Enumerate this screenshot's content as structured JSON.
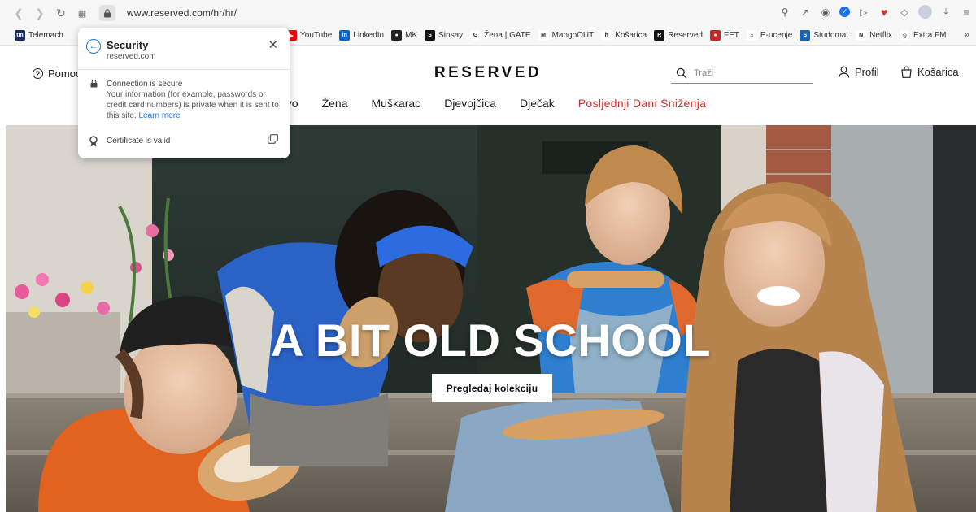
{
  "browser": {
    "url": "www.reserved.com/hr/hr/",
    "bookmarks_left": [
      {
        "label": "Telemach",
        "icon": "telemach-icon",
        "color": "#1d2d5a",
        "glyph": "tm"
      }
    ],
    "bookmarks_right": [
      {
        "label": "YouTube",
        "icon": "youtube-icon",
        "color": "#ff0000",
        "glyph": "▶"
      },
      {
        "label": "LinkedIn",
        "icon": "linkedin-icon",
        "color": "#0a66c2",
        "glyph": "in"
      },
      {
        "label": "MK",
        "icon": "mk-icon",
        "color": "#222222",
        "glyph": "●"
      },
      {
        "label": "Sinsay",
        "icon": "sinsay-icon",
        "color": "#111111",
        "glyph": "S"
      },
      {
        "label": "Žena | GATE",
        "icon": "gate-icon",
        "color": "#ffffff",
        "glyph": "G"
      },
      {
        "label": "MangoOUT",
        "icon": "mango-icon",
        "color": "#ffffff",
        "glyph": "M"
      },
      {
        "label": "Košarica",
        "icon": "kosarica-bookmark-icon",
        "color": "#ffffff",
        "glyph": "h"
      },
      {
        "label": "Reserved",
        "icon": "reserved-icon",
        "color": "#111111",
        "glyph": "R"
      },
      {
        "label": "FET",
        "icon": "fet-icon",
        "color": "#c62828",
        "glyph": "●"
      },
      {
        "label": "E-ucenje",
        "icon": "e-ucenje-icon",
        "color": "#ffffff",
        "glyph": "⌂"
      },
      {
        "label": "Studomat",
        "icon": "studomat-icon",
        "color": "#1565c0",
        "glyph": "S"
      },
      {
        "label": "Netflix",
        "icon": "netflix-icon",
        "color": "#ffffff",
        "glyph": "N"
      },
      {
        "label": "Extra FM",
        "icon": "extra-fm-icon",
        "color": "#ffffff",
        "glyph": "◎"
      }
    ],
    "more": "»"
  },
  "popup": {
    "title": "Security",
    "domain": "reserved.com",
    "close": "✕",
    "connection": "Connection is secure",
    "info": "Your information (for example, passwords or credit card numbers) is private when it is sent to this site.",
    "learn_more": "Learn more",
    "certificate": "Certificate is valid"
  },
  "site": {
    "help": "Pomoć",
    "logo": "RESERVED",
    "search_placeholder": "Traži",
    "profile": "Profil",
    "cart": "Košarica",
    "nav": [
      "ovo",
      "Žena",
      "Muškarac",
      "Djevojčica",
      "Dječak",
      "Posljednji Dani Sniženja"
    ],
    "hero_title": "A BIT OLD SCHOOL",
    "cta": "Pregledaj kolekciju"
  },
  "colors": {
    "accent": "#1a73e8",
    "sale": "#d0302b"
  }
}
